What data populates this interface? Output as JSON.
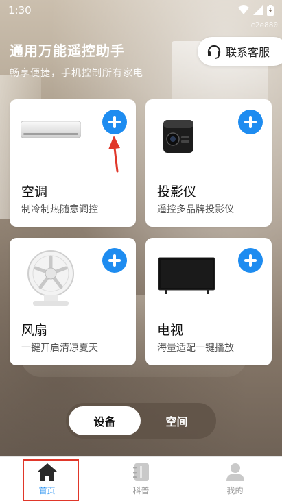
{
  "status_bar": {
    "time": "1:30"
  },
  "watermark": "c2e880",
  "header": {
    "title": "通用万能遥控助手",
    "subtitle": "畅享便捷，手机控制所有家电",
    "support_button": "联系客服"
  },
  "devices": [
    {
      "name": "空调",
      "desc": "制冷制热随意调控",
      "icon": "air-conditioner"
    },
    {
      "name": "投影仪",
      "desc": "遥控多品牌投影仪",
      "icon": "projector"
    },
    {
      "name": "风扇",
      "desc": "一键开启清凉夏天",
      "icon": "fan"
    },
    {
      "name": "电视",
      "desc": "海量适配一键播放",
      "icon": "television"
    }
  ],
  "toggle": {
    "active": "设备",
    "inactive": "空间"
  },
  "bottom_nav": [
    {
      "label": "首页",
      "icon": "home-icon",
      "active": true
    },
    {
      "label": "科普",
      "icon": "notebook-icon",
      "active": false
    },
    {
      "label": "我的",
      "icon": "person-icon",
      "active": false
    }
  ],
  "colors": {
    "accent": "#1e8cf0",
    "annotation": "#e0372a"
  }
}
